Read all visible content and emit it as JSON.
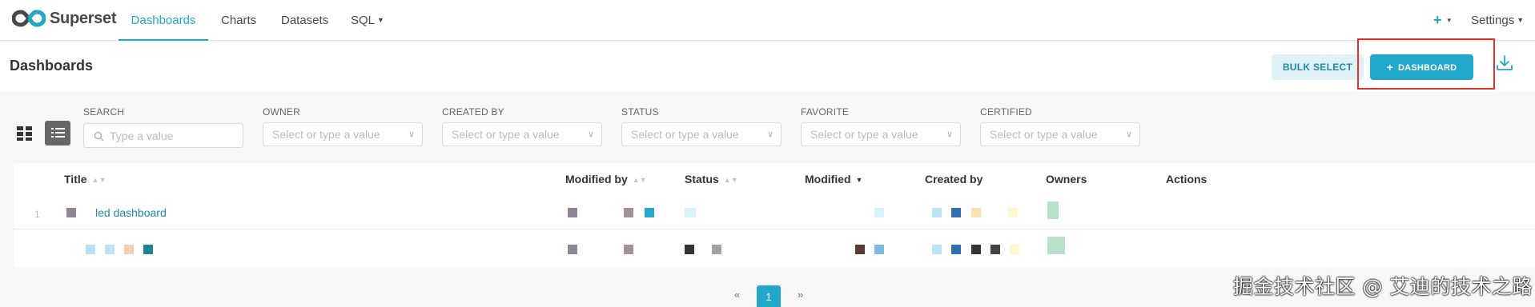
{
  "app": {
    "name": "Superset"
  },
  "nav": {
    "items": [
      "Dashboards",
      "Charts",
      "Datasets",
      "SQL"
    ],
    "plus": "+",
    "settings": "Settings"
  },
  "header": {
    "title": "Dashboards",
    "bulk_select": "BULK SELECT",
    "add_dashboard": "DASHBOARD"
  },
  "filters": [
    {
      "label": "SEARCH",
      "placeholder": "Type a value"
    },
    {
      "label": "OWNER",
      "placeholder": "Select or type a value"
    },
    {
      "label": "CREATED BY",
      "placeholder": "Select or type a value"
    },
    {
      "label": "STATUS",
      "placeholder": "Select or type a value"
    },
    {
      "label": "FAVORITE",
      "placeholder": "Select or type a value"
    },
    {
      "label": "CERTIFIED",
      "placeholder": "Select or type a value"
    }
  ],
  "table": {
    "columns": [
      "Title",
      "Modified by",
      "Status",
      "Modified",
      "Created by",
      "Owners",
      "Actions"
    ],
    "rows": [
      {
        "num": "1",
        "title": "led dashboard"
      }
    ]
  },
  "pagination": {
    "prev": "«",
    "current": "1",
    "next": "»"
  },
  "watermark": "掘金技术社区 @ 艾迪的技术之路",
  "colors": {
    "accent": "#20a7c9",
    "highlight": "#e8302d"
  }
}
